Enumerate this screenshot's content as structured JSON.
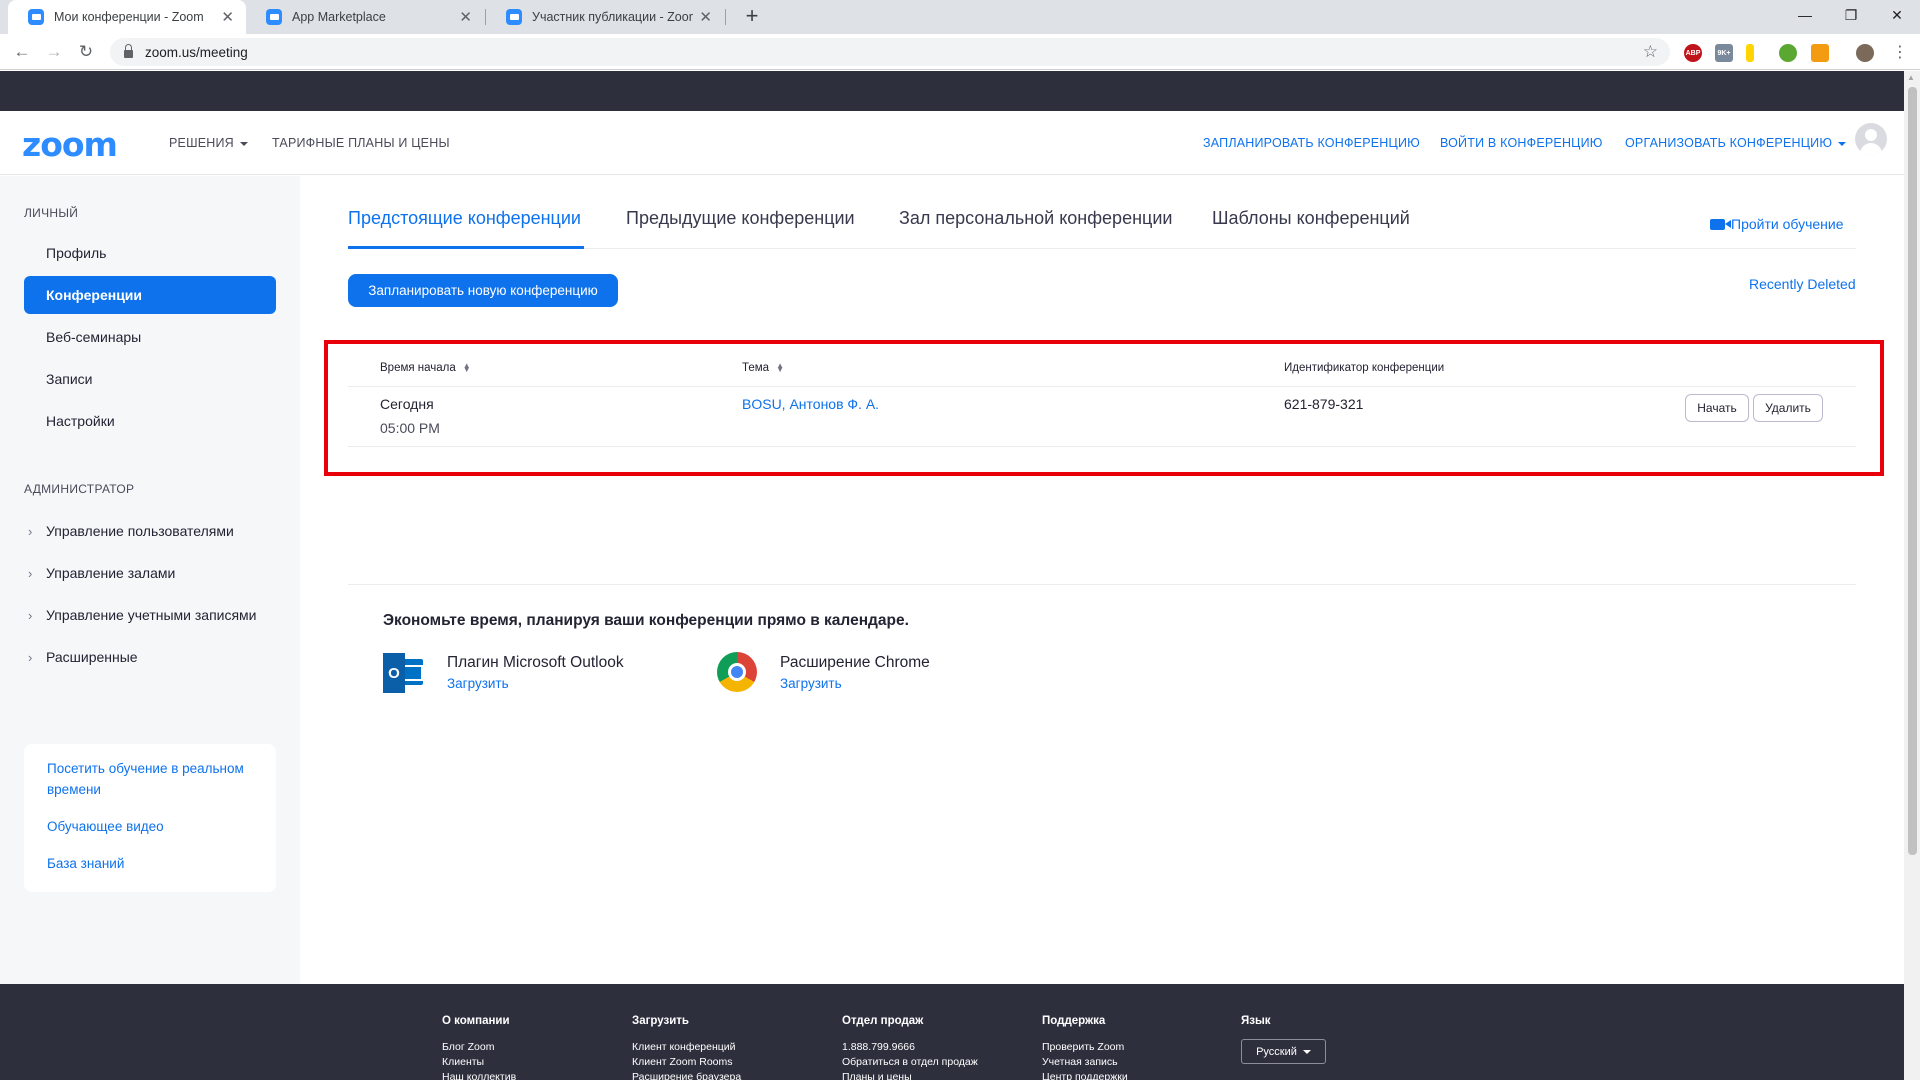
{
  "browser": {
    "tabs": [
      {
        "label": "Мои конференции - Zoom"
      },
      {
        "label": "App Marketplace"
      },
      {
        "label": "Участник публикации - Zoom"
      }
    ],
    "url": "zoom.us/meeting",
    "extensions": [
      "ABP",
      "9K+"
    ]
  },
  "header": {
    "logo": "zoom",
    "solutions": "РЕШЕНИЯ",
    "plans": "ТАРИФНЫЕ ПЛАНЫ И ЦЕНЫ",
    "schedule": "ЗАПЛАНИРОВАТЬ КОНФЕРЕНЦИЮ",
    "join": "ВОЙТИ В КОНФЕРЕНЦИЮ",
    "host": "ОРГАНИЗОВАТЬ КОНФЕРЕНЦИЮ"
  },
  "sidebar": {
    "personal_title": "ЛИЧНЫЙ",
    "personal_items": [
      {
        "label": "Профиль"
      },
      {
        "label": "Конференции"
      },
      {
        "label": "Веб-семинары"
      },
      {
        "label": "Записи"
      },
      {
        "label": "Настройки"
      }
    ],
    "admin_title": "АДМИНИСТРАТОР",
    "admin_items": [
      {
        "label": "Управление пользователями"
      },
      {
        "label": "Управление залами"
      },
      {
        "label": "Управление учетными записями"
      },
      {
        "label": "Расширенные"
      }
    ],
    "learning": [
      {
        "label": "Посетить обучение в реальном времени"
      },
      {
        "label": "Обучающее видео"
      },
      {
        "label": "База знаний"
      }
    ]
  },
  "main": {
    "tabs": [
      {
        "label": "Предстоящие конференции"
      },
      {
        "label": "Предыдущие конференции"
      },
      {
        "label": "Зал персональной конференции"
      },
      {
        "label": "Шаблоны конференций"
      }
    ],
    "training_link": "Пройти обучение",
    "schedule_button": "Запланировать новую конференцию",
    "recently_deleted": "Recently Deleted",
    "table": {
      "columns": [
        "Время начала",
        "Тема",
        "Идентификатор конференции"
      ],
      "rows": [
        {
          "day": "Сегодня",
          "time": "05:00 PM",
          "topic": "BOSU, Антонов Ф. А.",
          "meeting_id": "621-879-321",
          "start": "Начать",
          "delete": "Удалить"
        }
      ]
    },
    "promo": {
      "title": "Экономьте время, планируя ваши конференции прямо в календаре.",
      "outlook_name": "Плагин Microsoft Outlook",
      "outlook_link": "Загрузить",
      "chrome_name": "Расширение Chrome",
      "chrome_link": "Загрузить"
    }
  },
  "footer": {
    "columns": [
      {
        "title": "О компании",
        "links": [
          "Блог Zoom",
          "Клиенты",
          "Наш коллектив"
        ]
      },
      {
        "title": "Загрузить",
        "links": [
          "Клиент конференций",
          "Клиент Zoom Rooms",
          "Расширение браузера"
        ]
      },
      {
        "title": "Отдел продаж",
        "links": [
          "1.888.799.9666",
          "Обратиться в отдел продаж",
          "Планы и цены"
        ]
      },
      {
        "title": "Поддержка",
        "links": [
          "Проверить Zoom",
          "Учетная запись",
          "Центр поддержки"
        ]
      }
    ],
    "language_title": "Язык",
    "language_value": "Русский"
  },
  "colors": {
    "accent": "#0e72ed",
    "highlight": "#e8000b",
    "dark": "#2d2f3d"
  }
}
